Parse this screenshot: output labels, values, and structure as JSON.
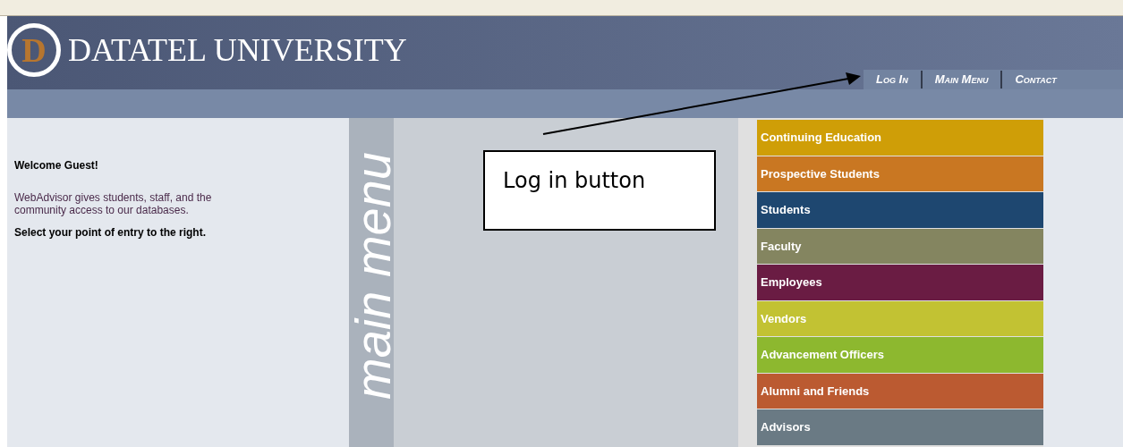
{
  "header": {
    "logo_letter": "D",
    "title": "DATATEL UNIVERSITY",
    "nav": [
      {
        "label": "Log In"
      },
      {
        "label": "Main Menu"
      },
      {
        "label": "Contact"
      }
    ]
  },
  "welcome": {
    "heading": "Welcome Guest!",
    "description": "WebAdvisor gives students, staff, and the community access to our databases.",
    "instruction": "Select your point of entry to the right."
  },
  "watermark_text": "main menu",
  "menu": [
    {
      "label": "Continuing Education",
      "color": "#cf9e07"
    },
    {
      "label": "Prospective Students",
      "color": "#c97722"
    },
    {
      "label": "Students",
      "color": "#1e4770"
    },
    {
      "label": "Faculty",
      "color": "#848560"
    },
    {
      "label": "Employees",
      "color": "#6a1c43"
    },
    {
      "label": "Vendors",
      "color": "#c2c233"
    },
    {
      "label": "Advancement Officers",
      "color": "#8db82f"
    },
    {
      "label": "Alumni and Friends",
      "color": "#bb5a31"
    },
    {
      "label": "Advisors",
      "color": "#6a7a84"
    }
  ],
  "annotation": {
    "text": "Log in button"
  }
}
